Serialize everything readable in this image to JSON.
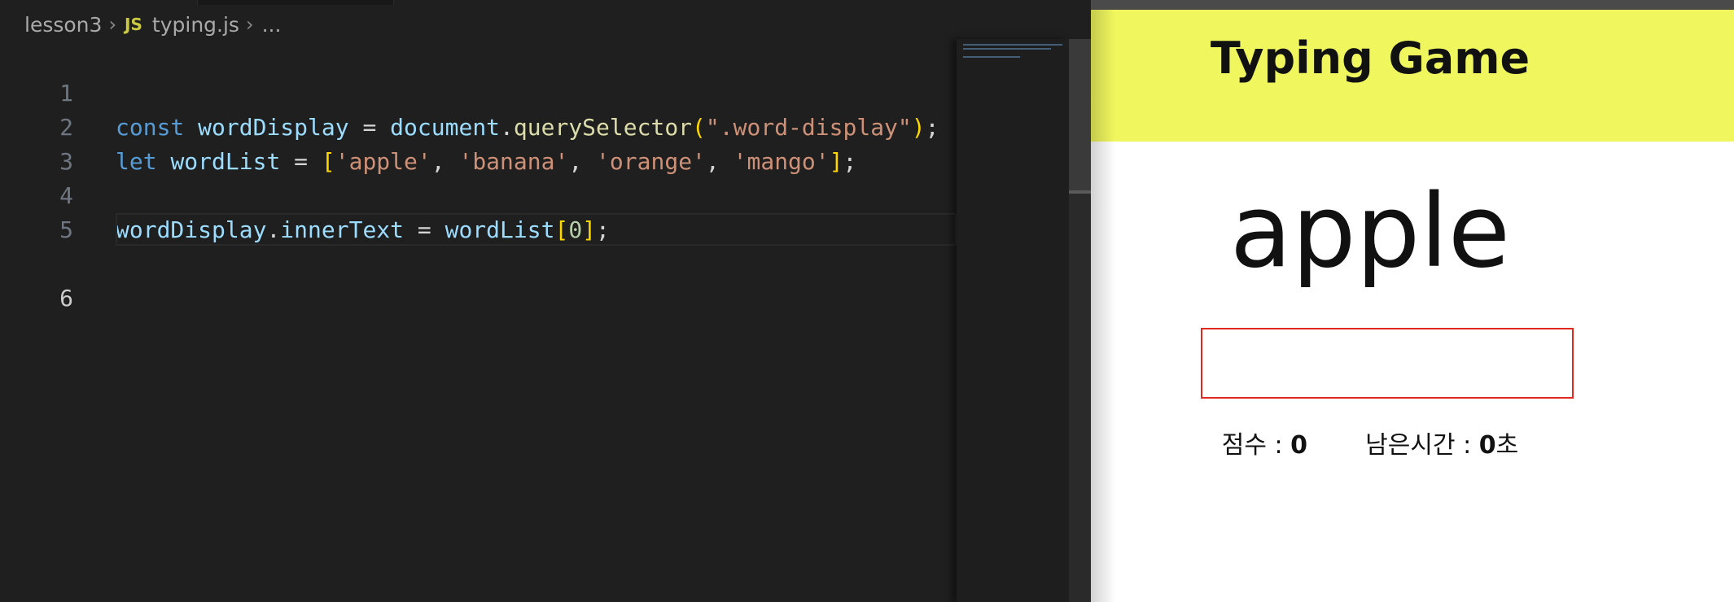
{
  "editor": {
    "breadcrumb": {
      "folder": "lesson3",
      "file_icon": "JS",
      "file": "typing.js",
      "more": "..."
    },
    "lines": [
      {
        "number": "1",
        "code": "const wordDisplay = document.querySelector(\".word-display\");"
      },
      {
        "number": "2",
        "code": "let wordList = ['apple', 'banana', 'orange', 'mango'];"
      },
      {
        "number": "3",
        "code": ""
      },
      {
        "number": "4",
        "code": "wordDisplay.innerText = wordList[0];"
      },
      {
        "number": "5",
        "code": ""
      },
      {
        "number": "6",
        "code": ""
      }
    ],
    "active_line": "6",
    "colors": {
      "background": "#1f1f1f",
      "keyword": "#569cd6",
      "variable": "#9cdcfe",
      "function": "#dcdcaa",
      "string": "#ce9178",
      "bracket": "#ffd700"
    }
  },
  "preview": {
    "title": "Typing Game",
    "word": "apple",
    "input_value": "",
    "score_label": "점수 :",
    "score_value": "0",
    "time_label": "남은시간 :",
    "time_value": "0",
    "time_unit": "초",
    "colors": {
      "header_bg": "#f0f75e",
      "input_border": "#e0281f"
    }
  }
}
